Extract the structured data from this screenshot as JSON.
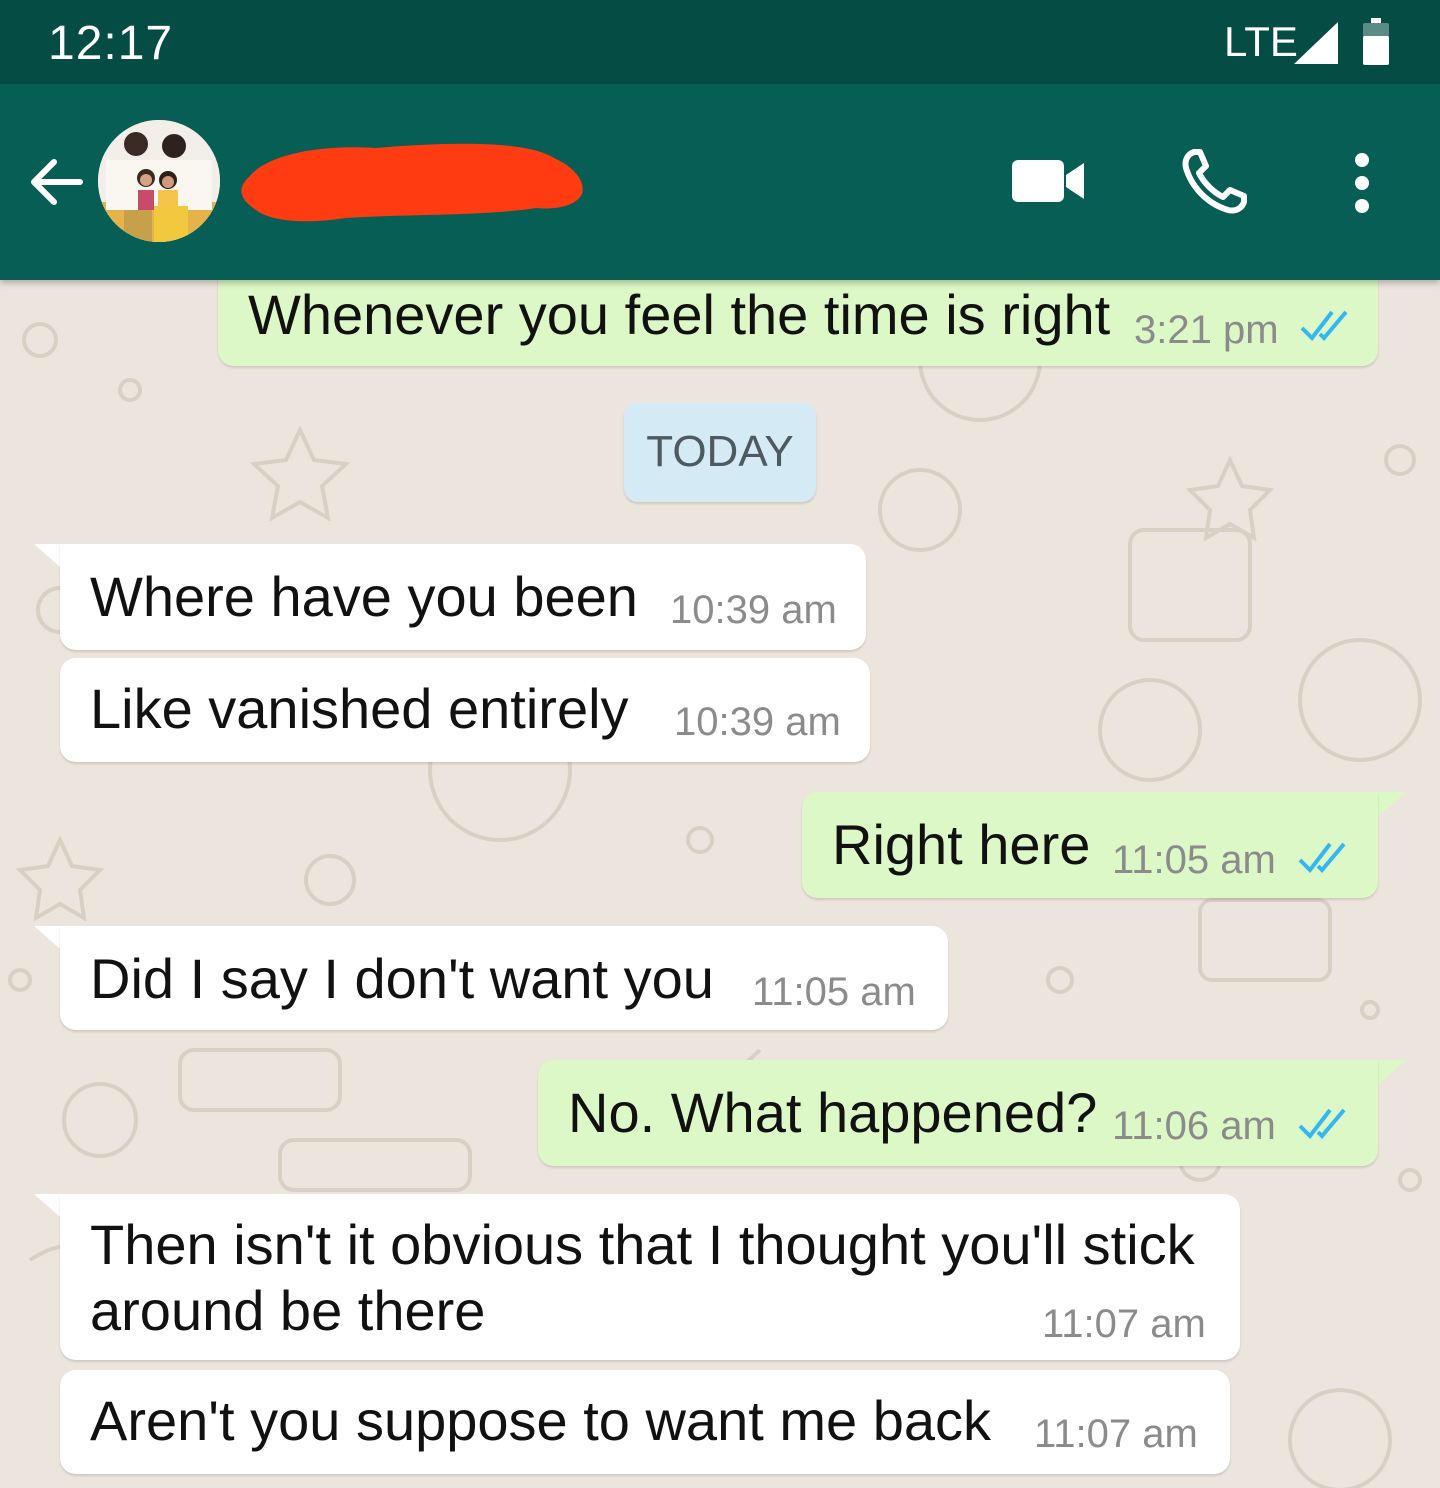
{
  "status_bar": {
    "time": "12:17",
    "network": "LTE"
  },
  "header": {
    "contact_name": ""
  },
  "chat": {
    "date_divider": "TODAY",
    "messages": [
      {
        "direction": "outgoing",
        "text": "Whenever you feel the time is right",
        "time": "3:21 pm",
        "read": true
      },
      {
        "direction": "incoming",
        "text": "Where have you been",
        "time": "10:39 am"
      },
      {
        "direction": "incoming",
        "text": "Like vanished entirely",
        "time": "10:39 am"
      },
      {
        "direction": "outgoing",
        "text": "Right here",
        "time": "11:05 am",
        "read": true
      },
      {
        "direction": "incoming",
        "text": "Did I say I don't want you",
        "time": "11:05 am"
      },
      {
        "direction": "outgoing",
        "text": "No. What happened?",
        "time": "11:06 am",
        "read": true
      },
      {
        "direction": "incoming",
        "text_line1": "Then isn't it obvious that I thought you'll stick",
        "text_line2": "around be there",
        "time": "11:07 am"
      },
      {
        "direction": "incoming",
        "text": "Aren't you suppose to want me back",
        "time": "11:07 am"
      }
    ]
  },
  "colors": {
    "status_bar": "#054c44",
    "app_bar": "#075e54",
    "incoming_bubble": "#ffffff",
    "outgoing_bubble": "#dcf8c6",
    "read_tick": "#34b7f1",
    "date_chip": "#d4eaf4"
  },
  "icons": [
    "signal-icon",
    "battery-icon",
    "back-arrow-icon",
    "video-call-icon",
    "voice-call-icon",
    "more-options-icon",
    "read-receipt-icon"
  ]
}
